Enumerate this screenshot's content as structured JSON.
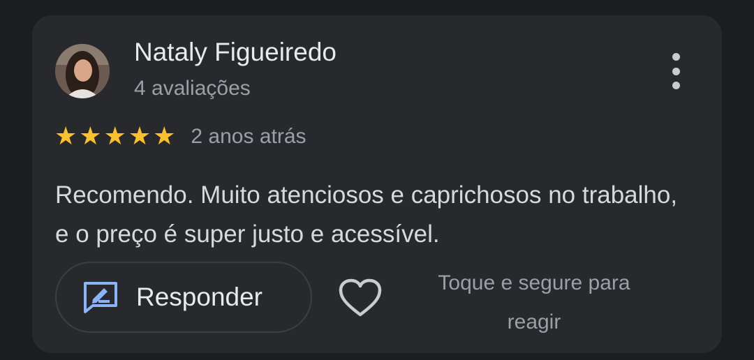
{
  "review": {
    "author": {
      "name": "Nataly Figueiredo",
      "review_count": "4 avaliações",
      "avatar_icon": "profile-photo"
    },
    "menu_icon": "more-vertical-icon",
    "rating": {
      "stars": 5,
      "max_stars": 5,
      "star_glyph": "★",
      "date": "2 anos atrás"
    },
    "text": "Recomendo. Muito atenciosos e caprichosos no trabalho, e o preço é super justo e acessível.",
    "actions": {
      "reply_label": "Responder",
      "reply_icon": "reply-edit-icon",
      "heart_icon": "heart-outline-icon",
      "react_hint": "Toque e segure para reagir"
    }
  },
  "colors": {
    "background": "#1c1d1f",
    "card": "#28292c",
    "star": "#fbc02d",
    "accent_blue": "#8ab4f8",
    "primary_text": "#e8eaed",
    "secondary_text": "#9aa0a6"
  }
}
